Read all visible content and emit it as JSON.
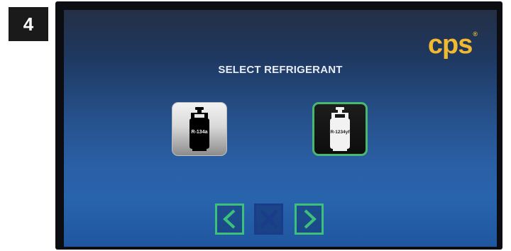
{
  "step": {
    "number": "4"
  },
  "logo": {
    "text": "cps",
    "reg_mark": "®",
    "color": "#f1b82d"
  },
  "screen": {
    "title": "SELECT REFRIGERANT"
  },
  "options": [
    {
      "label": "R-134a",
      "selected": false,
      "icon": "refrigerant-tank-icon"
    },
    {
      "label": "R-1234yf",
      "selected": true,
      "icon": "refrigerant-tank-icon",
      "accent": "#48b870"
    }
  ],
  "nav": {
    "back_icon": "chevron-left-icon",
    "cancel_icon": "x-icon",
    "forward_icon": "chevron-right-icon",
    "button_border_color": "#3cc07a",
    "cancel_color": "#1a3c8a"
  }
}
